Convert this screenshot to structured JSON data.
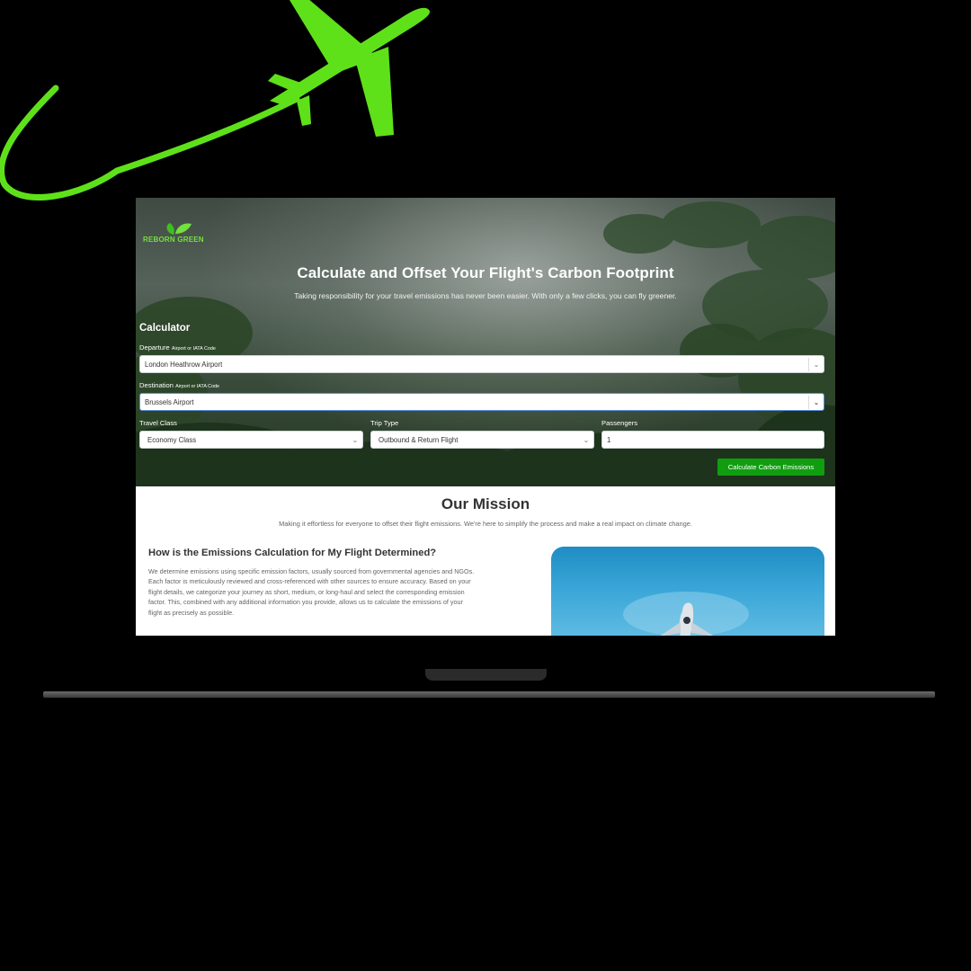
{
  "brand": {
    "logo_word1": "REBORN",
    "logo_word2": "GREEN",
    "accent": "#74e13c"
  },
  "hero": {
    "title": "Calculate and Offset Your Flight's Carbon Footprint",
    "subtitle": "Taking responsibility for your travel emissions has never been easier. With only a few clicks, you can fly greener."
  },
  "calculator": {
    "title": "Calculator",
    "departure": {
      "label": "Departure",
      "hint": "Airport or IATA Code",
      "value": "London Heathrow Airport"
    },
    "destination": {
      "label": "Destination",
      "hint": "Airport or IATA Code",
      "value": "Brussels Airport"
    },
    "travel_class": {
      "label": "Travel Class",
      "value": "Economy Class"
    },
    "trip_type": {
      "label": "Trip Type",
      "value": "Outbound & Return Flight"
    },
    "passengers": {
      "label": "Passengers",
      "value": "1"
    },
    "submit_label": "Calculate Carbon Emissions",
    "button_color": "#109e10"
  },
  "mission": {
    "title": "Our Mission",
    "subtitle": "Making it effortless for everyone to offset their flight emissions. We're here to simplify the process and make a real impact on climate change."
  },
  "how": {
    "title": "How is the Emissions Calculation for My Flight Determined?",
    "body_lines": [
      "We determine emissions using specific emission factors, usually sourced from governmental agencies and NGOs.",
      "Each factor is meticulously reviewed and cross-referenced with other sources to ensure accuracy. Based on your",
      "flight details, we categorize your journey as short, medium, or long-haul and select the corresponding emission",
      "factor. This, combined with any additional information you provide, allows us to calculate the emissions of your",
      "flight as precisely as possible."
    ]
  },
  "icons": {
    "decoration": "airplane-icon",
    "dropdown": "chevron-down-icon",
    "logo": "leaf-icon"
  }
}
